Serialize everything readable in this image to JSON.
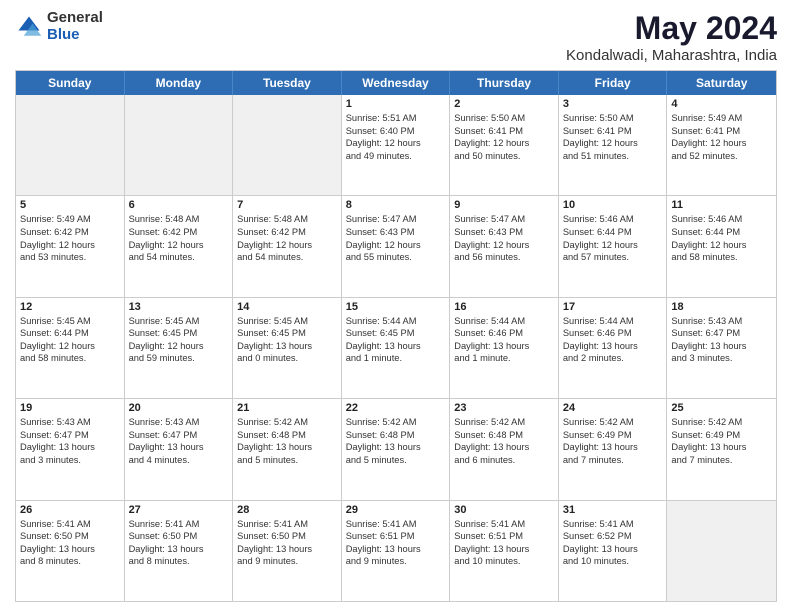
{
  "logo": {
    "general": "General",
    "blue": "Blue"
  },
  "title": "May 2024",
  "subtitle": "Kondalwadi, Maharashtra, India",
  "columns": [
    "Sunday",
    "Monday",
    "Tuesday",
    "Wednesday",
    "Thursday",
    "Friday",
    "Saturday"
  ],
  "rows": [
    [
      {
        "day": "",
        "text": "",
        "shaded": true
      },
      {
        "day": "",
        "text": "",
        "shaded": true
      },
      {
        "day": "",
        "text": "",
        "shaded": true
      },
      {
        "day": "1",
        "text": "Sunrise: 5:51 AM\nSunset: 6:40 PM\nDaylight: 12 hours\nand 49 minutes.",
        "shaded": false
      },
      {
        "day": "2",
        "text": "Sunrise: 5:50 AM\nSunset: 6:41 PM\nDaylight: 12 hours\nand 50 minutes.",
        "shaded": false
      },
      {
        "day": "3",
        "text": "Sunrise: 5:50 AM\nSunset: 6:41 PM\nDaylight: 12 hours\nand 51 minutes.",
        "shaded": false
      },
      {
        "day": "4",
        "text": "Sunrise: 5:49 AM\nSunset: 6:41 PM\nDaylight: 12 hours\nand 52 minutes.",
        "shaded": false
      }
    ],
    [
      {
        "day": "5",
        "text": "Sunrise: 5:49 AM\nSunset: 6:42 PM\nDaylight: 12 hours\nand 53 minutes.",
        "shaded": false
      },
      {
        "day": "6",
        "text": "Sunrise: 5:48 AM\nSunset: 6:42 PM\nDaylight: 12 hours\nand 54 minutes.",
        "shaded": false
      },
      {
        "day": "7",
        "text": "Sunrise: 5:48 AM\nSunset: 6:42 PM\nDaylight: 12 hours\nand 54 minutes.",
        "shaded": false
      },
      {
        "day": "8",
        "text": "Sunrise: 5:47 AM\nSunset: 6:43 PM\nDaylight: 12 hours\nand 55 minutes.",
        "shaded": false
      },
      {
        "day": "9",
        "text": "Sunrise: 5:47 AM\nSunset: 6:43 PM\nDaylight: 12 hours\nand 56 minutes.",
        "shaded": false
      },
      {
        "day": "10",
        "text": "Sunrise: 5:46 AM\nSunset: 6:44 PM\nDaylight: 12 hours\nand 57 minutes.",
        "shaded": false
      },
      {
        "day": "11",
        "text": "Sunrise: 5:46 AM\nSunset: 6:44 PM\nDaylight: 12 hours\nand 58 minutes.",
        "shaded": false
      }
    ],
    [
      {
        "day": "12",
        "text": "Sunrise: 5:45 AM\nSunset: 6:44 PM\nDaylight: 12 hours\nand 58 minutes.",
        "shaded": false
      },
      {
        "day": "13",
        "text": "Sunrise: 5:45 AM\nSunset: 6:45 PM\nDaylight: 12 hours\nand 59 minutes.",
        "shaded": false
      },
      {
        "day": "14",
        "text": "Sunrise: 5:45 AM\nSunset: 6:45 PM\nDaylight: 13 hours\nand 0 minutes.",
        "shaded": false
      },
      {
        "day": "15",
        "text": "Sunrise: 5:44 AM\nSunset: 6:45 PM\nDaylight: 13 hours\nand 1 minute.",
        "shaded": false
      },
      {
        "day": "16",
        "text": "Sunrise: 5:44 AM\nSunset: 6:46 PM\nDaylight: 13 hours\nand 1 minute.",
        "shaded": false
      },
      {
        "day": "17",
        "text": "Sunrise: 5:44 AM\nSunset: 6:46 PM\nDaylight: 13 hours\nand 2 minutes.",
        "shaded": false
      },
      {
        "day": "18",
        "text": "Sunrise: 5:43 AM\nSunset: 6:47 PM\nDaylight: 13 hours\nand 3 minutes.",
        "shaded": false
      }
    ],
    [
      {
        "day": "19",
        "text": "Sunrise: 5:43 AM\nSunset: 6:47 PM\nDaylight: 13 hours\nand 3 minutes.",
        "shaded": false
      },
      {
        "day": "20",
        "text": "Sunrise: 5:43 AM\nSunset: 6:47 PM\nDaylight: 13 hours\nand 4 minutes.",
        "shaded": false
      },
      {
        "day": "21",
        "text": "Sunrise: 5:42 AM\nSunset: 6:48 PM\nDaylight: 13 hours\nand 5 minutes.",
        "shaded": false
      },
      {
        "day": "22",
        "text": "Sunrise: 5:42 AM\nSunset: 6:48 PM\nDaylight: 13 hours\nand 5 minutes.",
        "shaded": false
      },
      {
        "day": "23",
        "text": "Sunrise: 5:42 AM\nSunset: 6:48 PM\nDaylight: 13 hours\nand 6 minutes.",
        "shaded": false
      },
      {
        "day": "24",
        "text": "Sunrise: 5:42 AM\nSunset: 6:49 PM\nDaylight: 13 hours\nand 7 minutes.",
        "shaded": false
      },
      {
        "day": "25",
        "text": "Sunrise: 5:42 AM\nSunset: 6:49 PM\nDaylight: 13 hours\nand 7 minutes.",
        "shaded": false
      }
    ],
    [
      {
        "day": "26",
        "text": "Sunrise: 5:41 AM\nSunset: 6:50 PM\nDaylight: 13 hours\nand 8 minutes.",
        "shaded": false
      },
      {
        "day": "27",
        "text": "Sunrise: 5:41 AM\nSunset: 6:50 PM\nDaylight: 13 hours\nand 8 minutes.",
        "shaded": false
      },
      {
        "day": "28",
        "text": "Sunrise: 5:41 AM\nSunset: 6:50 PM\nDaylight: 13 hours\nand 9 minutes.",
        "shaded": false
      },
      {
        "day": "29",
        "text": "Sunrise: 5:41 AM\nSunset: 6:51 PM\nDaylight: 13 hours\nand 9 minutes.",
        "shaded": false
      },
      {
        "day": "30",
        "text": "Sunrise: 5:41 AM\nSunset: 6:51 PM\nDaylight: 13 hours\nand 10 minutes.",
        "shaded": false
      },
      {
        "day": "31",
        "text": "Sunrise: 5:41 AM\nSunset: 6:52 PM\nDaylight: 13 hours\nand 10 minutes.",
        "shaded": false
      },
      {
        "day": "",
        "text": "",
        "shaded": true
      }
    ]
  ]
}
